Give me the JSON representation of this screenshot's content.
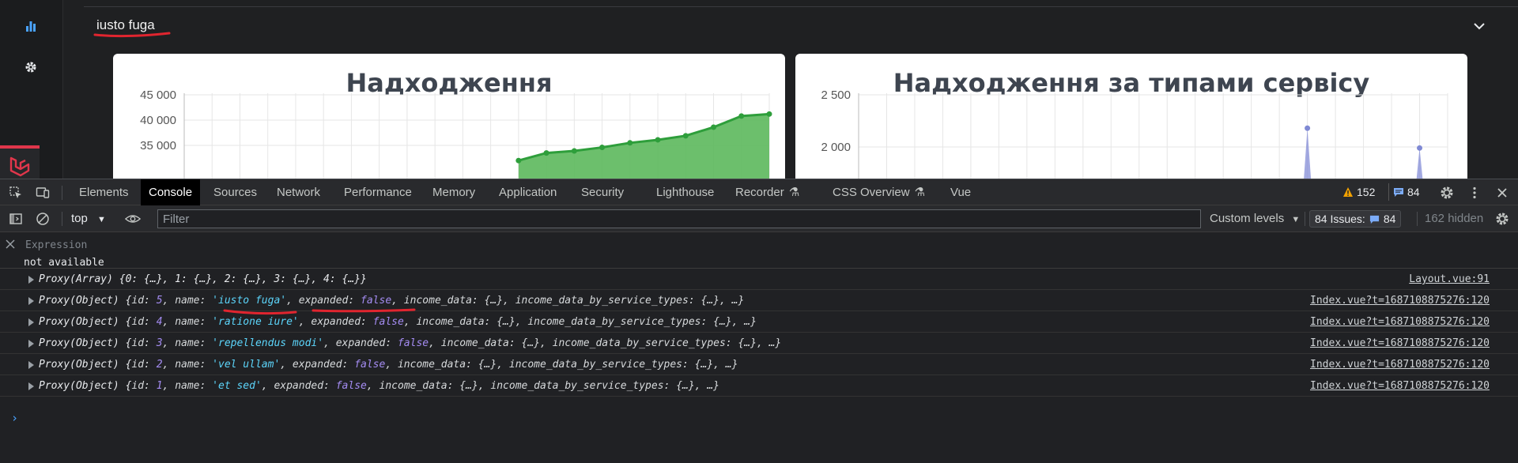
{
  "app": {
    "project_title": "iusto fuga",
    "cards": [
      {
        "title": "Надходження"
      },
      {
        "title": "Надходження за типами сервісу"
      }
    ]
  },
  "chart_data": [
    {
      "type": "area",
      "title": "Надходження",
      "y_ticks": [
        "45 000",
        "40 000",
        "35 000"
      ],
      "ylim_visible": [
        33000,
        46000
      ],
      "grid": true,
      "color": "#2e9e3b",
      "points": [
        {
          "x": 12,
          "y": 32000
        },
        {
          "x": 13,
          "y": 33500
        },
        {
          "x": 14,
          "y": 33900
        },
        {
          "x": 15,
          "y": 34600
        },
        {
          "x": 16,
          "y": 35500
        },
        {
          "x": 17,
          "y": 36100
        },
        {
          "x": 18,
          "y": 36900
        },
        {
          "x": 19,
          "y": 38600
        },
        {
          "x": 20,
          "y": 40800
        },
        {
          "x": 21,
          "y": 41200
        }
      ]
    },
    {
      "type": "line",
      "title": "Надходження за типами сервісу",
      "y_ticks": [
        "2 500",
        "2 000"
      ],
      "ylim_visible": [
        1900,
        2550
      ],
      "grid": true,
      "color": "#8b93d9",
      "spikes": [
        {
          "x": 16,
          "y": 2180
        },
        {
          "x": 20,
          "y": 1990
        }
      ]
    }
  ],
  "devtools": {
    "tabs": [
      "Elements",
      "Console",
      "Sources",
      "Network",
      "Performance",
      "Memory",
      "Application",
      "Security",
      "Lighthouse",
      "Recorder",
      "CSS Overview",
      "Vue"
    ],
    "active_tab": "Console",
    "warnings_count": "152",
    "messages_count": "84",
    "toolbar": {
      "context": "top",
      "filter_placeholder": "Filter",
      "levels": "Custom levels",
      "issues_label": "84 Issues:",
      "issues_count": "84",
      "hidden": "162 hidden"
    },
    "expression": {
      "label": "Expression",
      "value": "not available"
    },
    "logs": [
      {
        "type": "array",
        "text": "Proxy(Array) {0: {…}, 1: {…}, 2: {…}, 3: {…}, 4: {…}}",
        "source": "Layout.vue:91"
      },
      {
        "type": "object",
        "id": "5",
        "name": "'iusto fuga'",
        "expanded": "false",
        "source": "Index.vue?t=1687108875276:120"
      },
      {
        "type": "object",
        "id": "4",
        "name": "'ratione iure'",
        "expanded": "false",
        "source": "Index.vue?t=1687108875276:120"
      },
      {
        "type": "object",
        "id": "3",
        "name": "'repellendus modi'",
        "expanded": "false",
        "source": "Index.vue?t=1687108875276:120"
      },
      {
        "type": "object",
        "id": "2",
        "name": "'vel ullam'",
        "expanded": "false",
        "source": "Index.vue?t=1687108875276:120"
      },
      {
        "type": "object",
        "id": "1",
        "name": "'et sed'",
        "expanded": "false",
        "source": "Index.vue?t=1687108875276:120"
      }
    ],
    "log_parts": {
      "prefix": "Proxy(Object) {",
      "id_key": "id: ",
      "name_key": ", name: ",
      "expanded_key": ", expanded: ",
      "rest": ", income_data: {…}, income_data_by_service_types: {…}, …}"
    }
  },
  "colors": {
    "accent_red": "#e0364b",
    "active_icon": "#4aa3ff"
  }
}
